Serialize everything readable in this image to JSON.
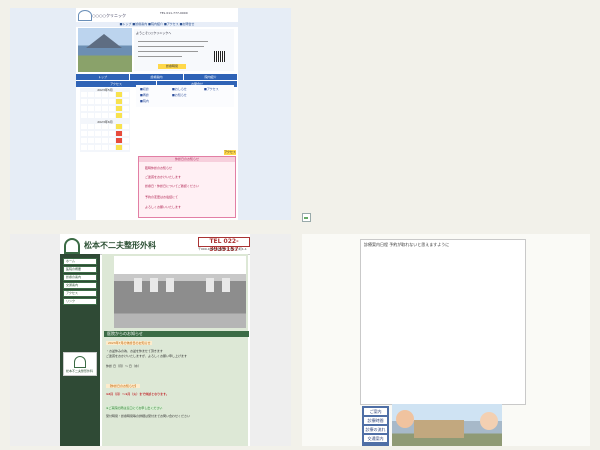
{
  "thumb1": {
    "clinic_name": "○○○○クリニック",
    "phone": "TEL 011-777-0000",
    "menu": "■トップ ■診療案内 ■院内紹介 ■アクセス ■お問合せ",
    "intro_title": "ようこそ○○クリニックへ",
    "hours_btn": "診療時間",
    "nav": [
      "トップ",
      "診療案内",
      "院内紹介",
      "アクセス",
      "お問合せ"
    ],
    "calendar_title_1": "2023年5月",
    "calendar_title_2": "2023年6月",
    "links": [
      "■初診",
      "■再診",
      "■院内",
      "■おしらせ",
      "■お知らせ",
      "■アクセス"
    ],
    "notice_title": "休診日のお知らせ",
    "notice_lines": [
      "臨時休診のお知らせ",
      "ご迷惑をおかけいたします",
      "診療日・休診日についてご確認ください",
      "予約の変更はお電話にて",
      "よろしくお願いいたします"
    ],
    "notice_btn": "アクセス",
    "colors": {
      "nav": "#2f63b6",
      "highlight": "#f8e24e",
      "closed": "#e74b3c",
      "notice": "#e27fa5"
    }
  },
  "thumb2": {
    "clinic_name": "松本不二夫整形外科",
    "phone": "TEL 022-3939157",
    "sub": "〒000-0000 仙台市○○区○○町1-1",
    "side_items": [
      "ホーム",
      "医院の概要",
      "診療の案内",
      "交通案内",
      "アクセス",
      "リンク"
    ],
    "badge_text": "松本不二夫整形外科",
    "news_title": "医院からのお知らせ",
    "news_lines": [
      {
        "t": "2023年7月の休診日のお知らせ",
        "c": "o"
      },
      {
        "t": "・お盆休みの為、お盆を休ませて頂きます",
        "c": ""
      },
      {
        "t": "ご迷惑をおかけいたしますが、よろしくお願い申し上げます",
        "c": ""
      },
      {
        "t": "休診 日（月）〜 日（水）",
        "c": ""
      },
      {
        "t": "【休診日のお知らせ】",
        "c": "o"
      },
      {
        "t": "12月（月）〜1月（火）まで休診となります。",
        "c": "r"
      },
      {
        "t": "※ご来院の際は窓口にてお申し出ください",
        "c": "g"
      },
      {
        "t": "受付時間・診療時間等の詳細は受付までお問い合わせください",
        "c": ""
      }
    ],
    "colors": {
      "side": "#2f4a35",
      "main": "#dde8d6",
      "accent": "#3b6b45"
    }
  },
  "thumb3": {
    "frame_title": "診療案内日程 予約が取れないと思えますように",
    "side_items": [
      "ご案内",
      "診療時間",
      "診療の流れ",
      "交通案内"
    ],
    "colors": {
      "side": "#4f6fa6"
    }
  }
}
